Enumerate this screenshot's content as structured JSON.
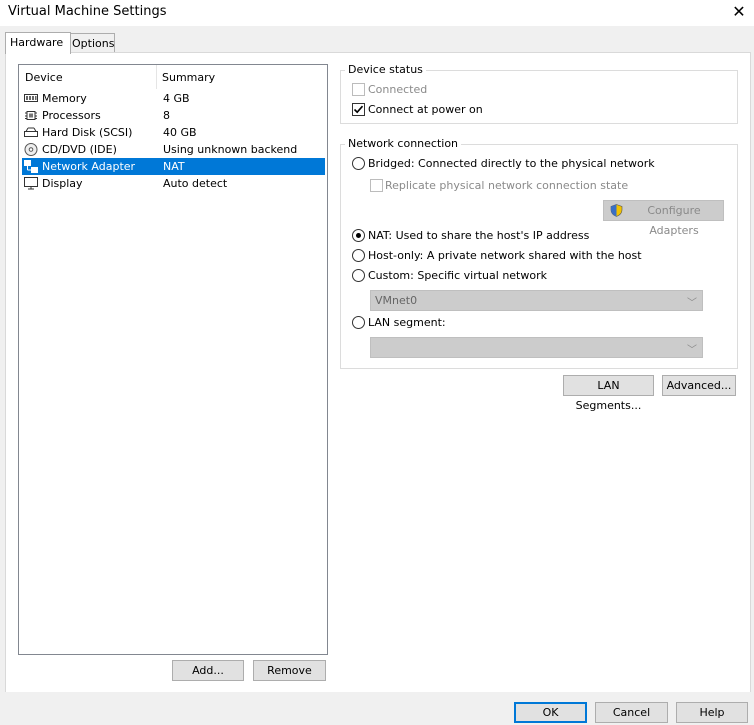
{
  "window": {
    "title": "Virtual Machine Settings"
  },
  "tabs": [
    {
      "label": "Hardware"
    },
    {
      "label": "Options"
    }
  ],
  "device_list": {
    "headers": {
      "device": "Device",
      "summary": "Summary"
    },
    "rows": [
      {
        "name": "Memory",
        "summary": "4 GB",
        "icon": "memory-icon"
      },
      {
        "name": "Processors",
        "summary": "8",
        "icon": "processor-icon"
      },
      {
        "name": "Hard Disk (SCSI)",
        "summary": "40 GB",
        "icon": "hard-disk-icon"
      },
      {
        "name": "CD/DVD (IDE)",
        "summary": "Using unknown backend",
        "icon": "cd-dvd-icon"
      },
      {
        "name": "Network Adapter",
        "summary": "NAT",
        "icon": "network-adapter-icon",
        "selected": true
      },
      {
        "name": "Display",
        "summary": "Auto detect",
        "icon": "display-icon"
      }
    ],
    "add_label": "Add...",
    "remove_label": "Remove"
  },
  "device_status": {
    "title": "Device status",
    "connected_label": "Connected",
    "connect_power_on_label": "Connect at power on"
  },
  "network_connection": {
    "title": "Network connection",
    "bridged_label": "Bridged: Connected directly to the physical network",
    "replicate_label": "Replicate physical network connection state",
    "configure_label": "Configure Adapters",
    "nat_label": "NAT: Used to share the host's IP address",
    "hostonly_label": "Host-only: A private network shared with the host",
    "custom_label": "Custom: Specific virtual network",
    "custom_value": "VMnet0",
    "lan_label": "LAN segment:",
    "lan_value": ""
  },
  "lan_segments_label": "LAN Segments...",
  "advanced_label": "Advanced...",
  "footer": {
    "ok": "OK",
    "cancel": "Cancel",
    "help": "Help"
  }
}
